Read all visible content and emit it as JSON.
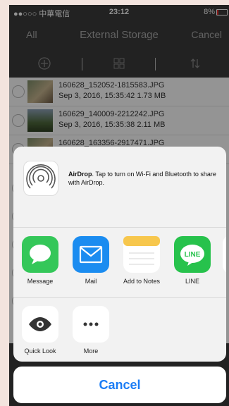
{
  "status_bar": {
    "carrier": "●●○○○ 中華電信",
    "time": "23:12",
    "battery": "8%"
  },
  "nav": {
    "left": "All",
    "title": "External Storage",
    "right": "Cancel"
  },
  "toolbar": {
    "icons": [
      "add-circle-icon",
      "grid-icon",
      "sort-icon"
    ]
  },
  "files": [
    {
      "name": "160628_152052-1815583.JPG",
      "meta": "Sep 3, 2016, 15:35:42  1.73 MB"
    },
    {
      "name": "160629_140009-2212242.JPG",
      "meta": "Sep 3, 2016, 15:35:38  2.11 MB"
    },
    {
      "name": "160628_163356-2917471.JPG",
      "meta": ""
    }
  ],
  "share_sheet": {
    "airdrop": {
      "title": "AirDrop",
      "text": ". Tap to turn on Wi-Fi and Bluetooth to share with AirDrop."
    },
    "apps": [
      {
        "label": "Message",
        "icon": "message-icon",
        "color": "#34c759"
      },
      {
        "label": "Mail",
        "icon": "mail-icon",
        "color": "#1b8cf0"
      },
      {
        "label": "Add to Notes",
        "icon": "notes-icon",
        "color": "#f7c74d"
      },
      {
        "label": "LINE",
        "icon": "line-icon",
        "color": "#27c24c"
      }
    ],
    "actions": [
      {
        "label": "Quick Look",
        "icon": "eye-icon"
      },
      {
        "label": "More",
        "icon": "more-icon"
      }
    ],
    "cancel": "Cancel"
  }
}
